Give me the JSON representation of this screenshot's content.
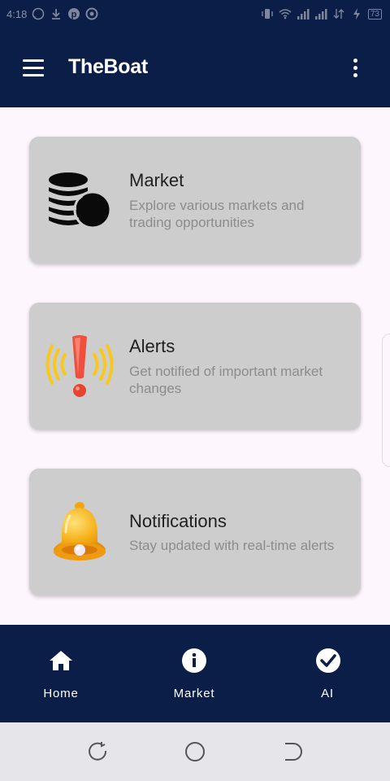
{
  "status_bar": {
    "time": "4:18",
    "notification_icons": [
      "whatsapp-icon",
      "download-icon",
      "pinterest-icon",
      "circle-app-icon"
    ],
    "system_icons": [
      "vibrate-icon",
      "wifi-icon",
      "signal-icon",
      "signal-icon",
      "data-icon",
      "charging-icon"
    ],
    "battery": "73"
  },
  "app_bar": {
    "title": "TheBoat",
    "menu_icon": "hamburger-menu-icon",
    "overflow_icon": "more-vertical-icon"
  },
  "cards": [
    {
      "title": "Market",
      "description": "Explore various markets and trading opportunities",
      "icon": "coins-icon"
    },
    {
      "title": "Alerts",
      "description": "Get notified of important market changes",
      "icon": "alert-exclamation-icon"
    },
    {
      "title": "Notifications",
      "description": "Stay updated with real-time alerts",
      "icon": "bell-icon"
    }
  ],
  "bottom_nav": [
    {
      "label": "Home",
      "icon": "home-icon"
    },
    {
      "label": "Market",
      "icon": "info-icon"
    },
    {
      "label": "AI",
      "icon": "check-circle-icon"
    }
  ],
  "system_nav": [
    "recents-icon",
    "home-circle-icon",
    "back-icon"
  ],
  "colors": {
    "primary": "#0b1e47",
    "background": "#fdf7fd",
    "card": "#cdcdcd",
    "title_text": "#1f1f1f",
    "desc_text": "#8c8c8c",
    "alert_red": "#ef4f3c",
    "alert_yellow": "#f7c81e",
    "bell_gold": "#f6b21a"
  }
}
